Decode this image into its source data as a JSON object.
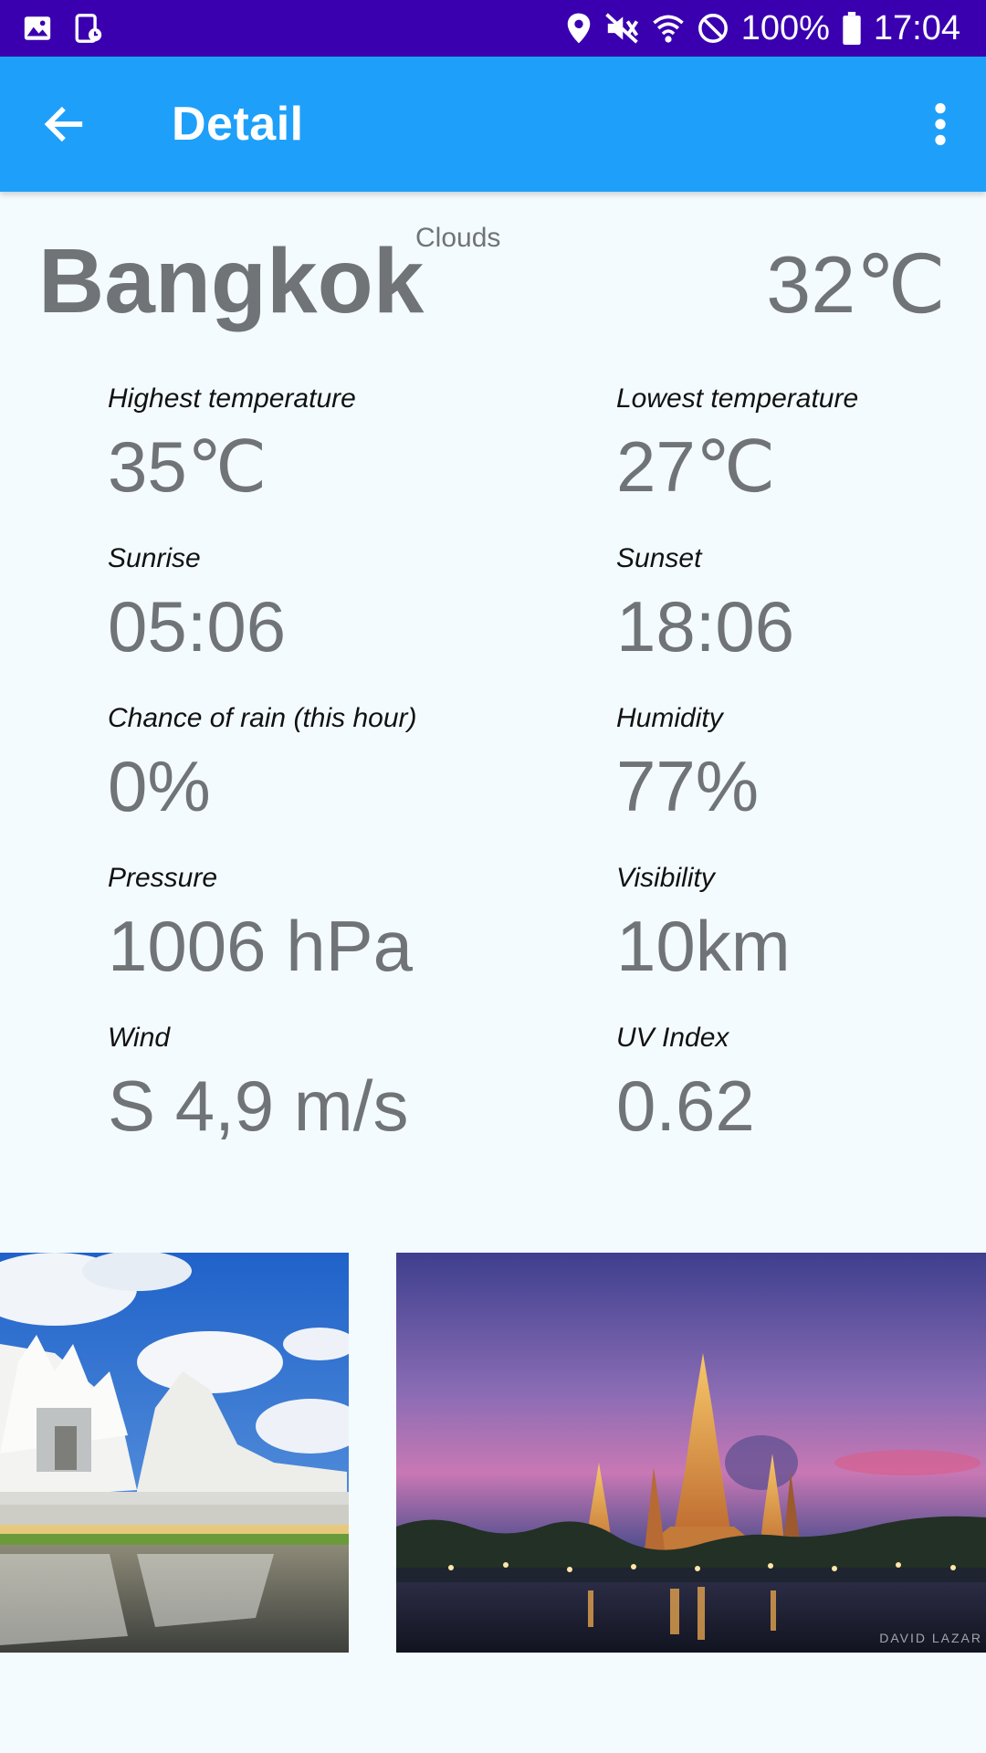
{
  "status_bar": {
    "battery": "100%",
    "time": "17:04"
  },
  "app_bar": {
    "title": "Detail"
  },
  "city": {
    "name": "Bangkok",
    "condition": "Clouds",
    "temperature": "32℃"
  },
  "stats": [
    {
      "label": "Highest temperature",
      "value": "35℃"
    },
    {
      "label": "Lowest temperature",
      "value": "27℃"
    },
    {
      "label": "Sunrise",
      "value": "05:06"
    },
    {
      "label": "Sunset",
      "value": "18:06"
    },
    {
      "label": "Chance of rain (this hour)",
      "value": "0%"
    },
    {
      "label": "Humidity",
      "value": "77%"
    },
    {
      "label": "Pressure",
      "value": "1006 hPa"
    },
    {
      "label": "Visibility",
      "value": "10km"
    },
    {
      "label": "Wind",
      "value": "S 4,9 m/s"
    },
    {
      "label": "UV Index",
      "value": "0.62"
    }
  ],
  "gallery": {
    "watermark": "DAVID LAZAR"
  },
  "colors": {
    "status_bar": "#3A00B0",
    "app_bar": "#1EA0FA",
    "background": "#F4FBFF",
    "value_text": "#707476"
  }
}
